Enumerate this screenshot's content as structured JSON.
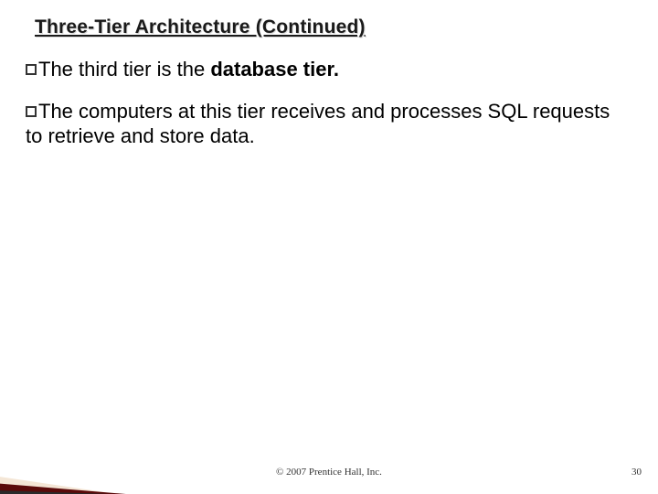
{
  "title": "Three-Tier Architecture (Continued)",
  "bullets": {
    "b1": {
      "pre": "The third tier is the ",
      "strong": "database tier.",
      "post": ""
    },
    "b2": {
      "text": "The computers at this tier receives and processes SQL requests to retrieve and store data."
    }
  },
  "footer": {
    "copyright": "© 2007 Prentice Hall, Inc.",
    "page": "30"
  }
}
